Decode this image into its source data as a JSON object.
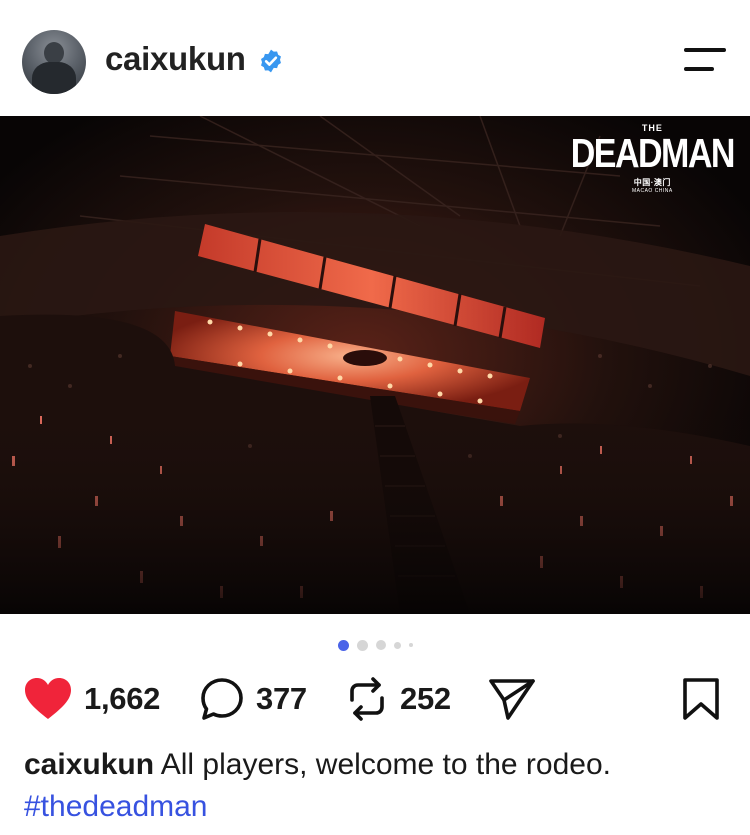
{
  "post": {
    "username": "caixukun",
    "verified": true,
    "caption_username": "caixukun",
    "caption_text": "All players, welcome to the rodeo.",
    "hashtag": "#thedeadman"
  },
  "watermark": {
    "small": "THE",
    "big": "DEADMAN",
    "sub": "中国·澳门",
    "sub2": "MACAO CHINA"
  },
  "carousel": {
    "total_visible_dots": 5,
    "active_index": 0
  },
  "actions": {
    "likes": "1,662",
    "comments": "377",
    "reposts": "252"
  },
  "icons": {
    "menu": "menu-icon",
    "verified": "verified-badge-icon",
    "like": "heart-icon",
    "comment": "comment-bubble-icon",
    "repost": "repost-icon",
    "share": "send-icon",
    "save": "bookmark-icon"
  },
  "colors": {
    "heart": "#f0243a",
    "verified": "#3897f0",
    "hashtag": "#3752e0",
    "active_dot": "#4a63e8"
  }
}
